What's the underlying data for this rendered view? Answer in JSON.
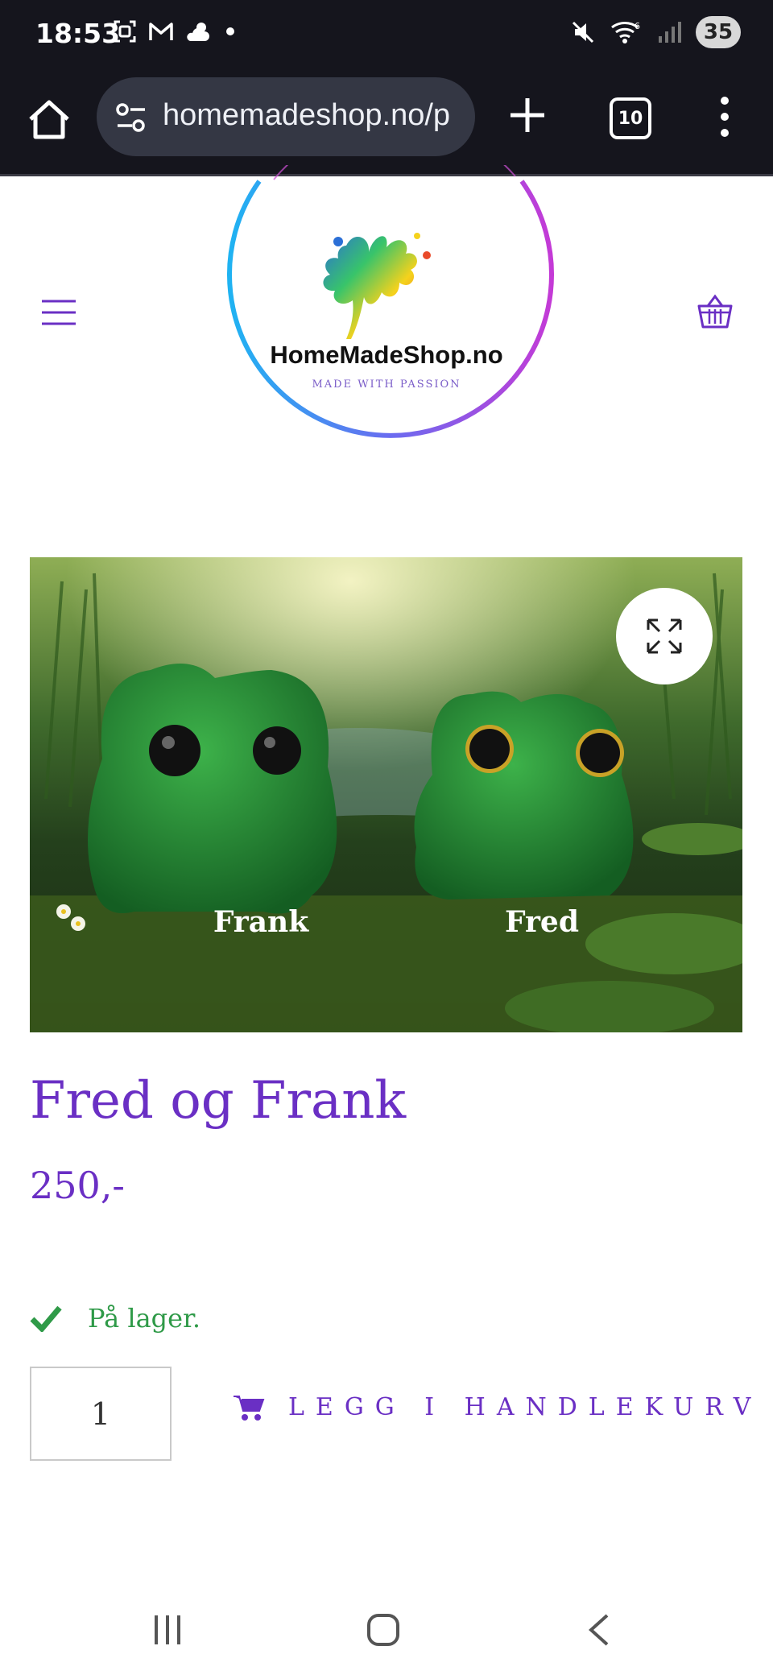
{
  "status_bar": {
    "time": "18:53",
    "battery": "35",
    "icons_left": [
      "screenshot-icon",
      "gmail-icon",
      "weather-icon",
      "dot-icon"
    ],
    "icons_right": [
      "mute-icon",
      "wifi-icon",
      "signal-icon",
      "battery-icon"
    ]
  },
  "browser": {
    "url": "homemadeshop.no/p",
    "tab_count": "10"
  },
  "logo": {
    "brand": "HomeMadeShop.no",
    "tagline": "MADE WITH PASSION"
  },
  "image": {
    "labels": [
      "Frank",
      "Fred"
    ]
  },
  "product": {
    "title": "Fred og Frank",
    "price": "250,-",
    "stock": "På lager.",
    "quantity": "1",
    "add_to_cart": "LEGG I HANDLEKURV"
  },
  "colors": {
    "accent": "#6a2fc4",
    "stock": "#2f9a48",
    "browser_bg": "#15151d"
  }
}
